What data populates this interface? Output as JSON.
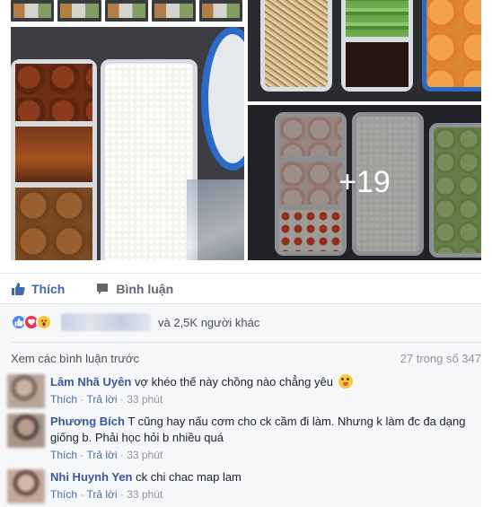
{
  "photos": {
    "more_overlay": "+19"
  },
  "actions": {
    "like_label": "Thích",
    "comment_label": "Bình luận"
  },
  "reactions": {
    "others_text": "và 2,5K người khác",
    "types": [
      "like-icon",
      "love-icon",
      "wow-icon"
    ]
  },
  "comments_header": {
    "view_previous": "Xem các bình luận trước",
    "count_text": "27 trong số 347"
  },
  "comments": [
    {
      "name": "Lâm Nhã Uyên",
      "text": "vợ khéo thế này chồng nào chẳng yêu",
      "like": "Thích",
      "reply": "Trả lời",
      "time": "33 phút"
    },
    {
      "name": "Phương Bích",
      "text": "T cũng hay nấu cơm cho ck cầm đi làm. Nhưng k làm đc đa dạng giống b. Phải học hỏi b nhiều quá",
      "like": "Thích",
      "reply": "Trả lời",
      "time": "33 phút"
    },
    {
      "name": "Nhi Huynh Yen",
      "text": "ck chi chac map lam",
      "like": "Thích",
      "reply": "Trả lời",
      "time": "33 phút"
    }
  ],
  "colors": {
    "accent": "#4267b2",
    "name_link": "#385898",
    "feed_bg": "#f6f7f9"
  }
}
